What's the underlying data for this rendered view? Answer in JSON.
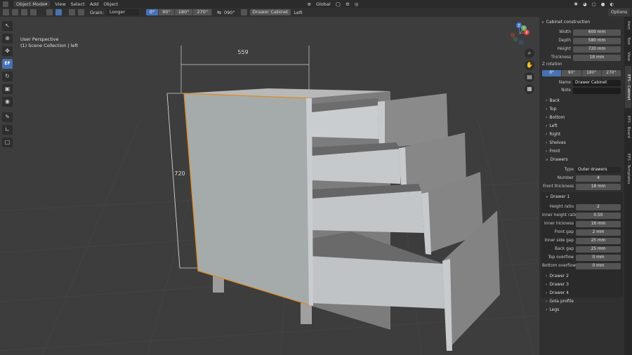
{
  "topbar": {
    "mode": "Object Mode",
    "menus": [
      "View",
      "Select",
      "Add",
      "Object"
    ],
    "orientation": "Global",
    "options": "Options"
  },
  "header": {
    "grain_label": "Grain:",
    "grain_value": "Longer",
    "angles": [
      "0°",
      "90°",
      "180°",
      "270°"
    ],
    "angle_readout": "090°",
    "object_name": "Drawer Cabinet",
    "side": "Left"
  },
  "viewport": {
    "perspective": "User Perspective",
    "collection": "(1) Scene Collection | left",
    "dim_width": "559",
    "dim_height": "720",
    "nav_labels": [
      "X",
      "Y",
      "Z"
    ]
  },
  "toolbar": {
    "ef_label": "EF"
  },
  "tabs": [
    "Item",
    "Tool",
    "View",
    "EFS - Cabinet",
    "EFS - Board",
    "EFS - Templates"
  ],
  "panel": {
    "title": "Cabinet construction",
    "width_label": "Width",
    "width": "600 mm",
    "depth_label": "Depth",
    "depth": "580 mm",
    "height_label": "Height",
    "height": "720 mm",
    "thickness_label": "Thickness",
    "thickness": "18 mm",
    "zrot_label": "Z rotation",
    "zrot": [
      "0°",
      "90°",
      "180°",
      "270°"
    ],
    "name_label": "Name",
    "name": "Drawer Cabinet",
    "note_label": "Note",
    "note": "",
    "sections": [
      "Back",
      "Top",
      "Bottom",
      "Left",
      "Right",
      "Shelves",
      "Front"
    ],
    "drawers": "Drawers",
    "type_label": "Type",
    "type": "Outer drawers",
    "number_label": "Number",
    "number": "4",
    "front_label": "Front thickness",
    "front": "18 mm",
    "drawer1": "Drawer 1",
    "fields": [
      {
        "label": "Height ratio",
        "value": "2"
      },
      {
        "label": "Inner height ratio",
        "value": "0.50"
      },
      {
        "label": "Inner hickness",
        "value": "16 mm"
      },
      {
        "label": "Front gap",
        "value": "2 mm"
      },
      {
        "label": "Inner side gap",
        "value": "25 mm"
      },
      {
        "label": "Back gap",
        "value": "25 mm"
      },
      {
        "label": "Top overflow",
        "value": "0 mm"
      },
      {
        "label": "Bottom overflow",
        "value": "0 mm"
      }
    ],
    "after": [
      "Drawer 2",
      "Drawer 3",
      "Drawer 4",
      "Gola profile",
      "Legs"
    ]
  }
}
